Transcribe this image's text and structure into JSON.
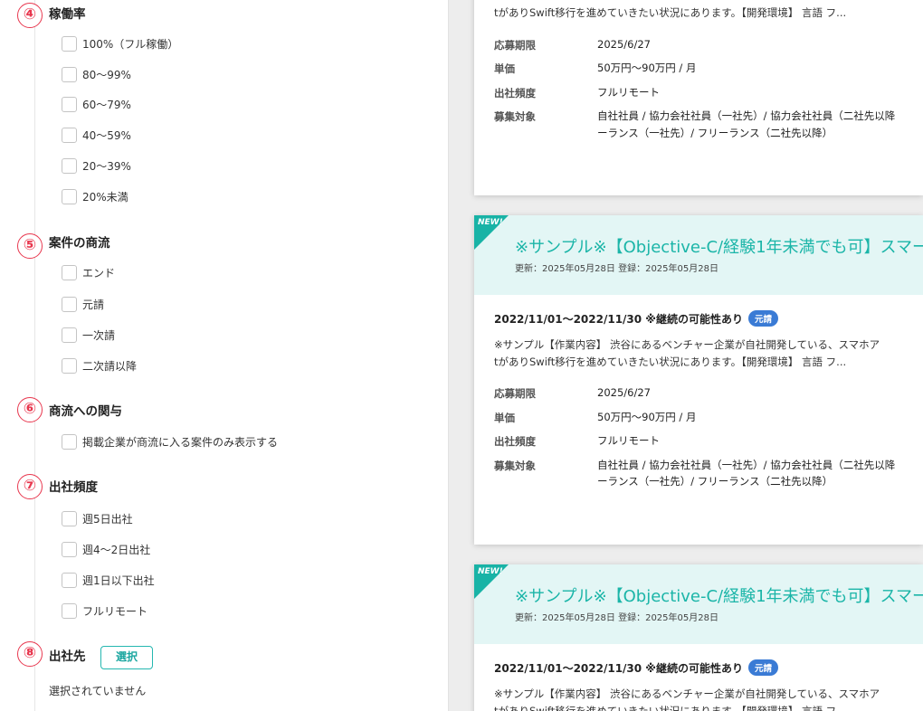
{
  "filters": {
    "availability": {
      "number": "④",
      "title": "稼働率",
      "options": [
        "100%（フル稼働）",
        "80～99%",
        "60～79%",
        "40～59%",
        "20～39%",
        "20%未満"
      ]
    },
    "commercial_flow": {
      "number": "⑤",
      "title": "案件の商流",
      "options": [
        "エンド",
        "元請",
        "一次請",
        "二次請以降"
      ]
    },
    "flow_involvement": {
      "number": "⑥",
      "title": "商流への関与",
      "options": [
        "掲載企業が商流に入る案件のみ表示する"
      ]
    },
    "attendance": {
      "number": "⑦",
      "title": "出社頻度",
      "options": [
        "週5日出社",
        "週4～2日出社",
        "週1日以下出社",
        "フルリモート"
      ]
    },
    "office": {
      "number": "⑧",
      "title": "出社先",
      "button": "選択",
      "status": "選択されていません"
    }
  },
  "cards": [
    {
      "desc_line2": "tがありSwift移行を進めていきたい状況にあります。【開発環境】 言語 フ...",
      "fields": [
        {
          "label": "応募期限",
          "value": "2025/6/27"
        },
        {
          "label": "単価",
          "value": "50万円～90万円 / 月"
        },
        {
          "label": "出社頻度",
          "value": "フルリモート"
        },
        {
          "label": "募集対象",
          "value": "自社社員 / 協力会社社員（一社先）/ 協力会社社員（二社先以降",
          "value2": "ーランス（一社先）/ フリーランス（二社先以降）"
        }
      ]
    },
    {
      "new": "NEW!",
      "title": "※サンプル※【Objective-C/経験1年未満でも可】スマー",
      "dates": "更新：2025年05月28日 登録：2025年05月28日",
      "period": "2022/11/01～2022/11/30 ※継続の可能性あり",
      "tag": "元請",
      "desc_line1": "※サンプル【作業内容】 渋谷にあるベンチャー企業が自社開発している、スマホア",
      "desc_line2": "tがありSwift移行を進めていきたい状況にあります。【開発環境】 言語 フ...",
      "fields": [
        {
          "label": "応募期限",
          "value": "2025/6/27"
        },
        {
          "label": "単価",
          "value": "50万円～90万円 / 月"
        },
        {
          "label": "出社頻度",
          "value": "フルリモート"
        },
        {
          "label": "募集対象",
          "value": "自社社員 / 協力会社社員（一社先）/ 協力会社社員（二社先以降",
          "value2": "ーランス（一社先）/ フリーランス（二社先以降）"
        }
      ]
    },
    {
      "new": "NEW!",
      "title": "※サンプル※【Objective-C/経験1年未満でも可】スマー",
      "dates": "更新：2025年05月28日 登録：2025年05月28日",
      "period": "2022/11/01～2022/11/30 ※継続の可能性あり",
      "tag": "元請",
      "desc_line1": "※サンプル【作業内容】 渋谷にあるベンチャー企業が自社開発している、スマホア",
      "desc_line2": "tがありSwift移行を進めていきたい状況にあります。【開発環境】 言語 フ..."
    }
  ],
  "colors": {
    "badge": "#e8384f",
    "accent": "#1bb5a8",
    "card_header": "#e3f6f5",
    "tag": "#3a7bd5"
  }
}
